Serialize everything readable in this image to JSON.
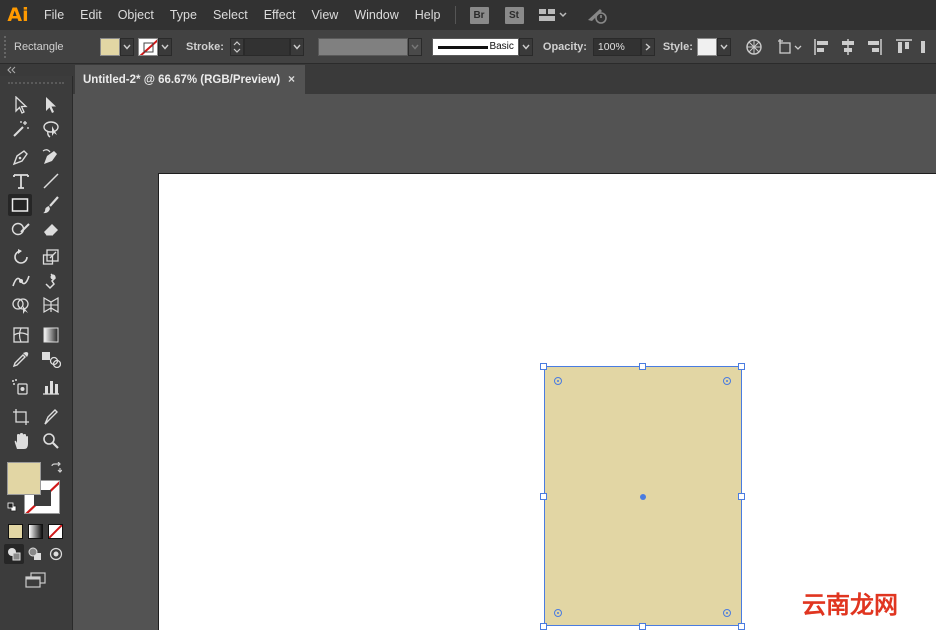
{
  "app": {
    "logo": "Ai"
  },
  "menu": {
    "items": [
      "File",
      "Edit",
      "Object",
      "Type",
      "Select",
      "Effect",
      "View",
      "Window",
      "Help"
    ],
    "bridge_label": "Br",
    "stock_label": "St"
  },
  "control": {
    "tool_name": "Rectangle",
    "fill_color": "#e2d6a4",
    "stroke_label": "Stroke:",
    "stroke_weight": "",
    "brush_label": "Basic",
    "opacity_label": "Opacity:",
    "opacity_value": "100%",
    "style_label": "Style:"
  },
  "document": {
    "tab_title": "Untitled-2* @ 66.67% (RGB/Preview)",
    "close_glyph": "×"
  },
  "tools": {
    "fill_color": "#e2d6a4",
    "stroke_color": "none",
    "active": "rectangle-tool"
  },
  "artwork": {
    "rect_fill": "#e2d6a4",
    "selection_color": "#4a7ce0"
  },
  "watermark": {
    "text": "云南龙网"
  }
}
